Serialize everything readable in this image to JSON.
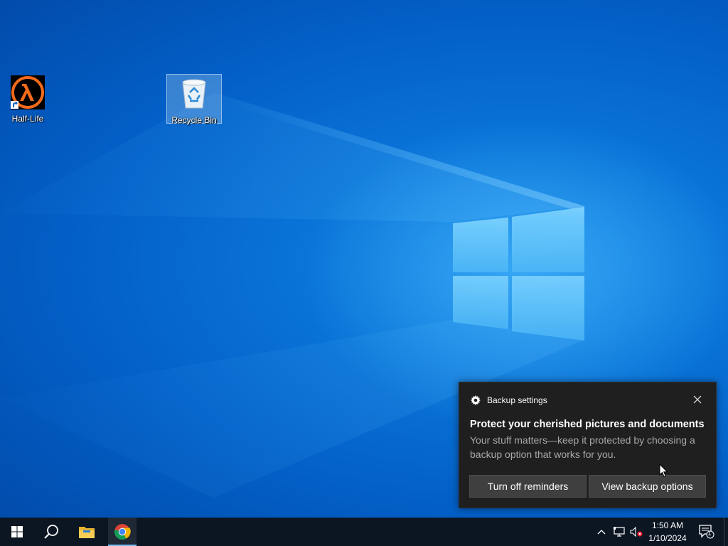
{
  "desktop": {
    "icons": [
      {
        "label": "Half-Life",
        "icon": "half-life-lambda-icon"
      },
      {
        "label": "Recycle Bin",
        "icon": "recycle-bin-icon"
      }
    ]
  },
  "toast": {
    "app_name": "Backup settings",
    "title": "Protect your cherished pictures and documents",
    "body": "Your stuff matters—keep it protected by choosing a backup option that works for you.",
    "buttons": {
      "turn_off": "Turn off reminders",
      "view_options": "View backup options"
    },
    "colors": {
      "background": "#1f1f1f",
      "button": "#3f3f3f",
      "body_text": "#a8a8a8"
    }
  },
  "taskbar": {
    "pinned": [
      {
        "name": "Start",
        "icon": "windows-logo-icon"
      },
      {
        "name": "Search",
        "icon": "search-icon"
      },
      {
        "name": "File Explorer",
        "icon": "folder-icon"
      },
      {
        "name": "Google Chrome",
        "icon": "chrome-icon",
        "active": true
      }
    ],
    "tray": {
      "icons": [
        "chevron-up-icon",
        "network-icon",
        "volume-muted-icon"
      ],
      "time": "1:50 AM",
      "date": "1/10/2024",
      "notification_count": "1"
    },
    "color": "#0c1623"
  }
}
